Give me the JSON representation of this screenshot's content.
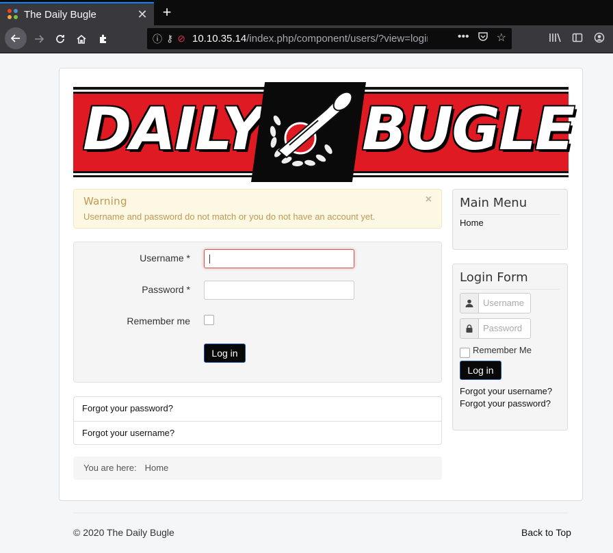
{
  "browser": {
    "tab_title": "The Daily Bugle",
    "tab_close_icon": "close-icon",
    "new_tab_icon": "plus-icon",
    "url_host": "10.10.35.14",
    "url_path": "/index.php/component/users/?view=login",
    "url_more": "•••"
  },
  "banner": {
    "left_word": "DAILY",
    "right_word": "BUGLE"
  },
  "warning": {
    "title": "Warning",
    "message": "Username and password do not match or you do not have an account yet.",
    "close": "×"
  },
  "login_form": {
    "username_label": "Username *",
    "username_value": "",
    "password_label": "Password *",
    "password_value": "",
    "remember_label": "Remember me",
    "submit_label": "Log in"
  },
  "links": {
    "forgot_password": "Forgot your password?",
    "forgot_username": "Forgot your username?"
  },
  "breadcrumb": {
    "prefix": "You are here:",
    "home": "Home"
  },
  "sidebar": {
    "main_menu": {
      "title": "Main Menu",
      "items": [
        "Home"
      ]
    },
    "login_module": {
      "title": "Login Form",
      "username_placeholder": "Username",
      "password_placeholder": "Password",
      "remember_label": "Remember Me",
      "submit_label": "Log in",
      "forgot_username": "Forgot your username?",
      "forgot_password": "Forgot your password?"
    }
  },
  "footer": {
    "copyright": "© 2020 The Daily Bugle",
    "back_to_top": "Back to Top"
  },
  "colors": {
    "banner_red": "#e01a22",
    "warning_text": "#c09853",
    "warning_bg": "#fcf8e3",
    "button_dark": "#080808",
    "browser_accent": "#0a84ff"
  }
}
